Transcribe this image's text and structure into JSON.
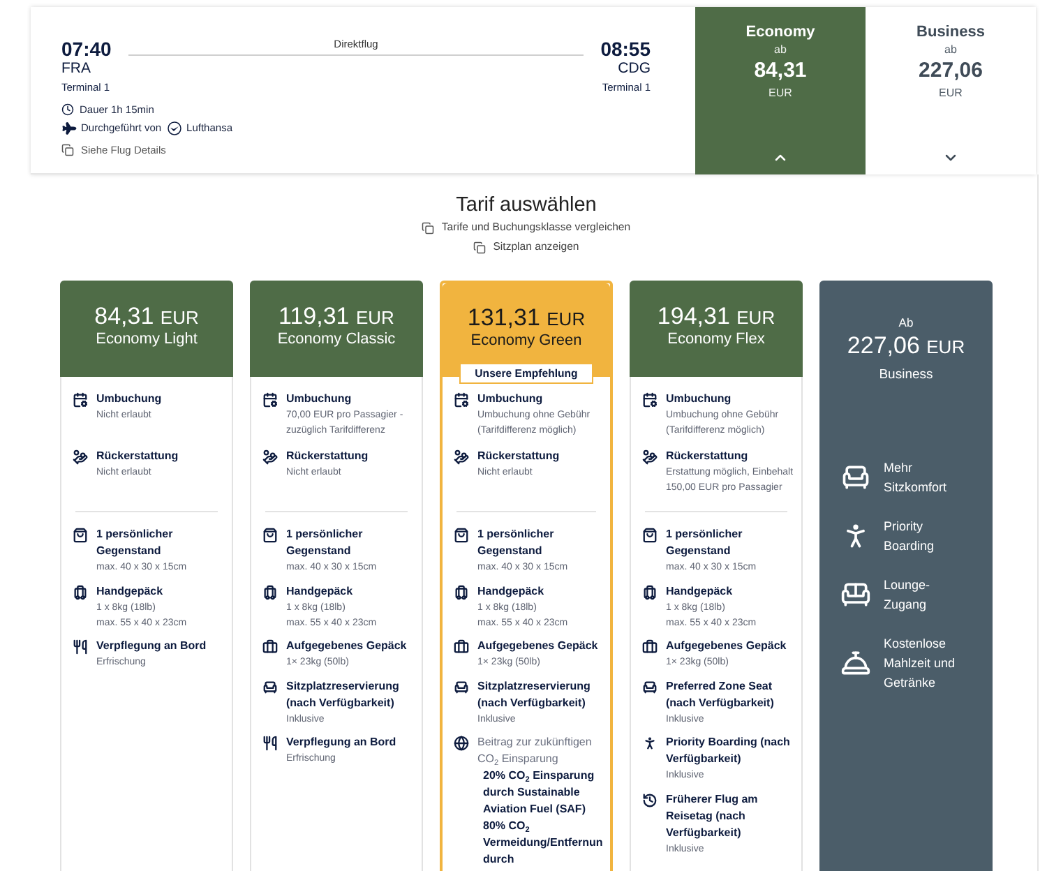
{
  "flight": {
    "departure": {
      "time": "07:40",
      "airport": "FRA",
      "terminal": "Terminal 1"
    },
    "route_label": "Direktflug",
    "arrival": {
      "time": "08:55",
      "airport": "CDG",
      "terminal": "Terminal 1"
    },
    "duration": "Dauer 1h 15min",
    "operated_by": "Durchgeführt von",
    "airline": "Lufthansa",
    "details_link": "Siehe Flug Details"
  },
  "cabins": [
    {
      "name": "Economy",
      "prefix": "ab",
      "price": "84,31",
      "currency": "EUR",
      "selected": true
    },
    {
      "name": "Business",
      "prefix": "ab",
      "price": "227,06",
      "currency": "EUR",
      "selected": false
    }
  ],
  "fare_selection": {
    "title": "Tarif auswählen",
    "links": [
      "Tarife und Buchungsklasse vergleichen",
      "Sitzplan anzeigen"
    ]
  },
  "fares": [
    {
      "price": "84,31",
      "currency": "EUR",
      "name": "Economy Light",
      "recommended": false,
      "conditions": [
        {
          "kind": "rebooking",
          "title": "Umbuchung",
          "details": [
            "Nicht erlaubt"
          ]
        },
        {
          "kind": "refund",
          "title": "Rückerstattung",
          "details": [
            "Nicht erlaubt"
          ]
        }
      ],
      "services": [
        {
          "kind": "personal_item",
          "title": "1 persönlicher Gegenstand",
          "details": [
            "max. 40 x 30 x 15cm"
          ]
        },
        {
          "kind": "hand_luggage",
          "title": "Handgepäck",
          "details": [
            "1 x 8kg (18lb)",
            "max. 55 x 40 x 23cm"
          ]
        },
        {
          "kind": "meal",
          "title": "Verpflegung an Bord",
          "details": [
            "Erfrischung"
          ]
        }
      ]
    },
    {
      "price": "119,31",
      "currency": "EUR",
      "name": "Economy Classic",
      "recommended": false,
      "conditions": [
        {
          "kind": "rebooking",
          "title": "Umbuchung",
          "details": [
            "70,00 EUR pro Passagier - zuzüglich Tarifdifferenz"
          ]
        },
        {
          "kind": "refund",
          "title": "Rückerstattung",
          "details": [
            "Nicht erlaubt"
          ]
        }
      ],
      "services": [
        {
          "kind": "personal_item",
          "title": "1 persönlicher Gegenstand",
          "details": [
            "max. 40 x 30 x 15cm"
          ]
        },
        {
          "kind": "hand_luggage",
          "title": "Handgepäck",
          "details": [
            "1 x 8kg (18lb)",
            "max. 55 x 40 x 23cm"
          ]
        },
        {
          "kind": "checked_bag",
          "title": "Aufgegebenes Gepäck",
          "details": [
            "1× 23kg (50lb)"
          ]
        },
        {
          "kind": "seat",
          "title": "Sitzplatzreservierung (nach Verfügbarkeit)",
          "details": [
            "Inklusive"
          ]
        },
        {
          "kind": "meal",
          "title": "Verpflegung an Bord",
          "details": [
            "Erfrischung"
          ]
        }
      ]
    },
    {
      "price": "131,31",
      "currency": "EUR",
      "name": "Economy Green",
      "recommended": true,
      "badge": "Unsere Empfehlung",
      "conditions": [
        {
          "kind": "rebooking",
          "title": "Umbuchung",
          "details": [
            "Umbuchung ohne Gebühr (Tarifdifferenz möglich)"
          ]
        },
        {
          "kind": "refund",
          "title": "Rückerstattung",
          "details": [
            "Nicht erlaubt"
          ]
        }
      ],
      "services": [
        {
          "kind": "personal_item",
          "title": "1 persönlicher Gegenstand",
          "details": [
            "max. 40 x 30 x 15cm"
          ]
        },
        {
          "kind": "hand_luggage",
          "title": "Handgepäck",
          "details": [
            "1 x 8kg (18lb)",
            "max. 55 x 40 x 23cm"
          ]
        },
        {
          "kind": "checked_bag",
          "title": "Aufgegebenes Gepäck",
          "details": [
            "1× 23kg (50lb)"
          ]
        },
        {
          "kind": "seat",
          "title": "Sitzplatzreservierung (nach Verfügbarkeit)",
          "details": [
            "Inklusive"
          ]
        },
        {
          "kind": "co2",
          "title": "Beitrag zur zukünftigen CO$_{2}$ Einsparung",
          "details": [
            "20% CO$_{2}$ Einsparung durch Sustainable Aviation Fuel (SAF)",
            "80% CO$_{2}$ Vermeidung/Entfernun durch"
          ]
        }
      ]
    },
    {
      "price": "194,31",
      "currency": "EUR",
      "name": "Economy Flex",
      "recommended": false,
      "conditions": [
        {
          "kind": "rebooking",
          "title": "Umbuchung",
          "details": [
            "Umbuchung ohne Gebühr (Tarifdifferenz möglich)"
          ]
        },
        {
          "kind": "refund",
          "title": "Rückerstattung",
          "details": [
            "Erstattung möglich, Einbehalt 150,00 EUR pro Passagier"
          ]
        }
      ],
      "services": [
        {
          "kind": "personal_item",
          "title": "1 persönlicher Gegenstand",
          "details": [
            "max. 40 x 30 x 15cm"
          ]
        },
        {
          "kind": "hand_luggage",
          "title": "Handgepäck",
          "details": [
            "1 x 8kg (18lb)",
            "max. 55 x 40 x 23cm"
          ]
        },
        {
          "kind": "checked_bag",
          "title": "Aufgegebenes Gepäck",
          "details": [
            "1× 23kg (50lb)"
          ]
        },
        {
          "kind": "seat",
          "title": "Preferred Zone Seat (nach Verfügbarkeit)",
          "details": [
            "Inklusive"
          ]
        },
        {
          "kind": "priority",
          "title": "Priority Boarding (nach Verfügbarkeit)",
          "details": [
            "Inklusive"
          ]
        },
        {
          "kind": "early_flight",
          "title": "Früherer Flug am Reisetag (nach Verfügbarkeit)",
          "details": [
            "Inklusive"
          ]
        }
      ]
    }
  ],
  "business_offer": {
    "prefix": "Ab",
    "price": "227,06",
    "currency": "EUR",
    "name": "Business",
    "perks": [
      {
        "kind": "seat",
        "label": "Mehr Sitzkomfort"
      },
      {
        "kind": "priority",
        "label": "Priority Boarding"
      },
      {
        "kind": "lounge",
        "label": "Lounge-Zugang"
      },
      {
        "kind": "meal",
        "label": "Kostenlose Mahlzeit und Getränke"
      }
    ]
  }
}
